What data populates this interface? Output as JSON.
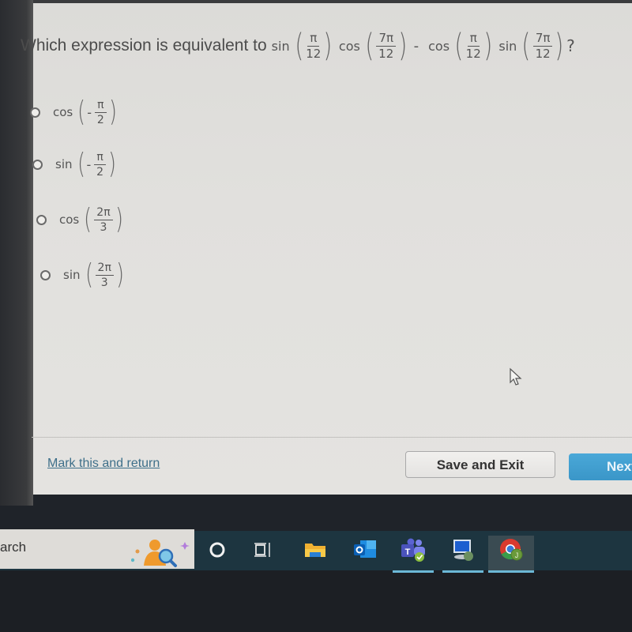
{
  "question": {
    "prefix": "Which expression is equivalent to",
    "terms": [
      {
        "fn": "sin",
        "num": "π",
        "den": "12"
      },
      {
        "fn": "cos",
        "num": "7π",
        "den": "12"
      },
      {
        "op": "-"
      },
      {
        "fn": "cos",
        "num": "π",
        "den": "12"
      },
      {
        "fn": "sin",
        "num": "7π",
        "den": "12"
      }
    ],
    "t1_fn": "sin",
    "t1_num": "π",
    "t1_den": "12",
    "t2_fn": "cos",
    "t2_num": "7π",
    "t2_den": "12",
    "op": "-",
    "t3_fn": "cos",
    "t3_num": "π",
    "t3_den": "12",
    "t4_fn": "sin",
    "t4_num": "7π",
    "t4_den": "12",
    "suffix": "?"
  },
  "options": [
    {
      "fn": "cos",
      "sign": "-",
      "num": "π",
      "den": "2",
      "selected": false
    },
    {
      "fn": "sin",
      "sign": "-",
      "num": "π",
      "den": "2",
      "selected": false
    },
    {
      "fn": "cos",
      "sign": "",
      "num": "2π",
      "den": "3",
      "selected": false
    },
    {
      "fn": "sin",
      "sign": "",
      "num": "2π",
      "den": "3",
      "selected": false
    }
  ],
  "footer": {
    "mark_link": "Mark this and return",
    "save_exit": "Save and Exit",
    "next": "Next"
  },
  "taskbar": {
    "search_text": "arch",
    "icons": [
      "search-highlight-icon",
      "cortana-icon",
      "task-view-icon",
      "file-explorer-icon",
      "outlook-icon",
      "teams-icon",
      "remote-desktop-icon",
      "chrome-icon"
    ]
  },
  "colors": {
    "link": "#3e6f8a",
    "next_button": "#3a96c8",
    "taskbar": "#1d3540"
  }
}
